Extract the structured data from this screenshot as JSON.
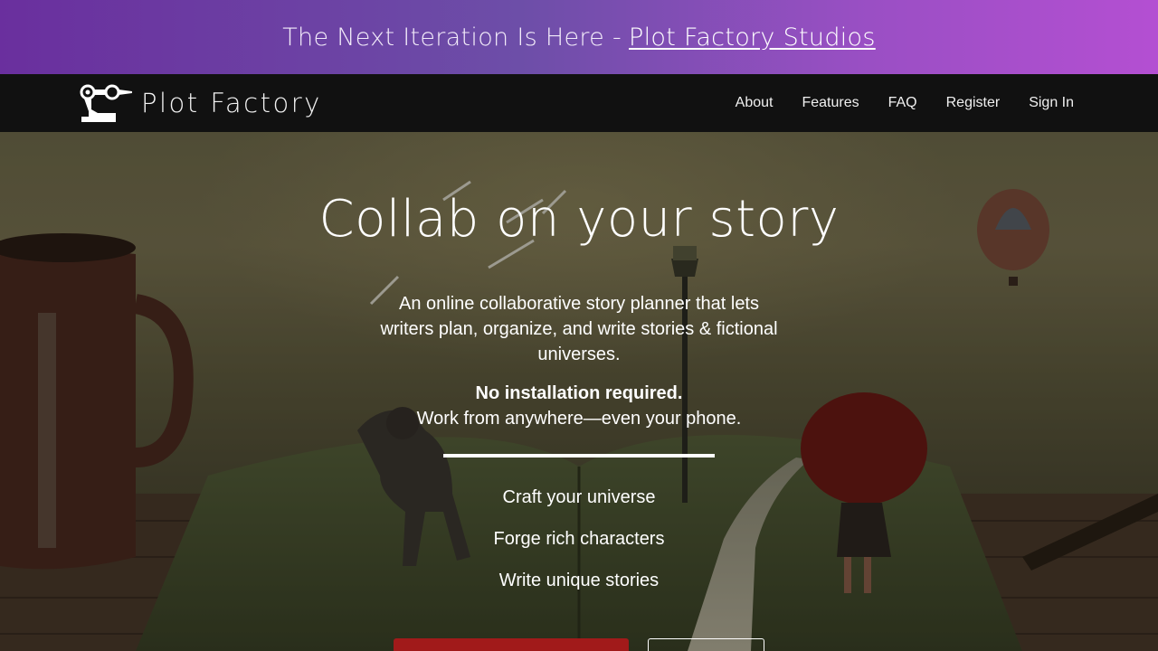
{
  "banner": {
    "text": "The Next Iteration Is Here - ",
    "link": "Plot Factory Studios"
  },
  "nav": {
    "brand": "Plot Factory",
    "links": [
      "About",
      "Features",
      "FAQ",
      "Register",
      "Sign In"
    ]
  },
  "hero": {
    "title": "Collab on your story",
    "description": "An online collaborative story planner that lets writers plan, organize, and write stories & fictional universes.",
    "bold": "No installation required.",
    "subtext": "Work from anywhere—even your phone.",
    "features": [
      "Craft your universe",
      "Forge rich characters",
      "Write unique stories"
    ]
  },
  "colors": {
    "banner_start": "#6a2f9e",
    "banner_end": "#b44fd2",
    "navbar": "#111111",
    "primary_button": "#a11a1a"
  }
}
